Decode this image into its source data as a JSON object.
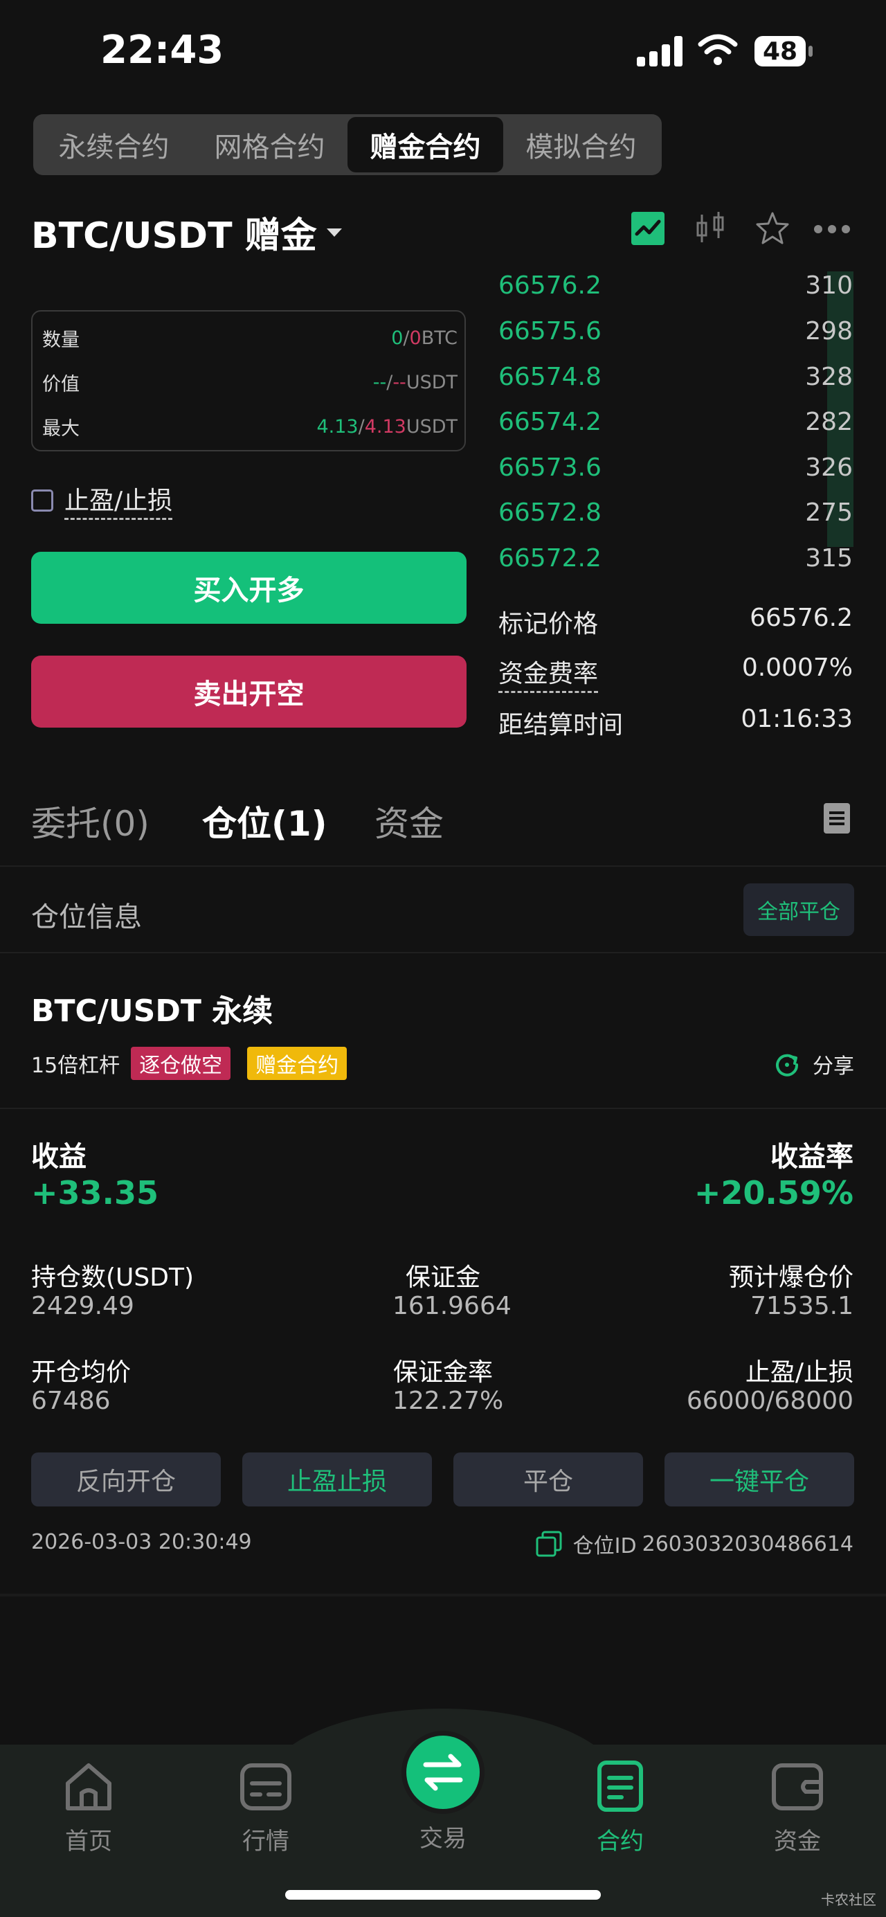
{
  "status_bar": {
    "time": "22:43",
    "battery": "48"
  },
  "top_tabs": [
    {
      "label": "永续合约",
      "active": false
    },
    {
      "label": "网格合约",
      "active": false
    },
    {
      "label": "赠金合约",
      "active": true
    },
    {
      "label": "模拟合约",
      "active": false
    }
  ],
  "pair": {
    "title": "BTC/USDT 赠金"
  },
  "order_info": {
    "rows": [
      {
        "label": "数量",
        "v1": "0",
        "sep": "/",
        "v2": "0",
        "unit": "BTC"
      },
      {
        "label": "价值",
        "v1": "--",
        "sep": "/",
        "v2": "--",
        "unit": "USDT"
      },
      {
        "label": "最大",
        "v1": "4.13",
        "sep": "/",
        "v2": "4.13",
        "unit": "USDT"
      }
    ]
  },
  "tpsl": {
    "label": "止盈/止损"
  },
  "buttons": {
    "buy": "买入开多",
    "sell": "卖出开空"
  },
  "order_book": [
    {
      "price": "66576.2",
      "qty": "310"
    },
    {
      "price": "66575.6",
      "qty": "298"
    },
    {
      "price": "66574.8",
      "qty": "328"
    },
    {
      "price": "66574.2",
      "qty": "282"
    },
    {
      "price": "66573.6",
      "qty": "326"
    },
    {
      "price": "66572.8",
      "qty": "275"
    },
    {
      "price": "66572.2",
      "qty": "315"
    }
  ],
  "market_stats": {
    "mark_label": "标记价格",
    "mark_value": "66576.2",
    "funding_label": "资金费率",
    "funding_value": "0.0007%",
    "settle_label": "距结算时间",
    "settle_value": "01:16:33"
  },
  "section_tabs": [
    {
      "label": "委托(0)",
      "active": false
    },
    {
      "label": "仓位(1)",
      "active": true
    },
    {
      "label": "资金",
      "active": false
    }
  ],
  "position_header": {
    "title": "仓位信息",
    "close_all": "全部平仓"
  },
  "position": {
    "symbol": "BTC/USDT 永续",
    "leverage": "15倍杠杆",
    "tag_short": "逐仓做空",
    "tag_bonus": "赠金合约",
    "share": "分享",
    "pnl_label": "收益",
    "pnl_value": "+33.35",
    "roe_label": "收益率",
    "roe_value": "+20.59%",
    "size_label": "持仓数(USDT)",
    "size_value": "2429.49",
    "margin_label": "保证金",
    "margin_value": "161.9664",
    "liq_label": "预计爆仓价",
    "liq_value": "71535.1",
    "entry_label": "开仓均价",
    "entry_value": "67486",
    "margin_ratio_label": "保证金率",
    "margin_ratio_value": "122.27%",
    "tpsl_label": "止盈/止损",
    "tpsl_value": "66000/68000",
    "actions": {
      "reverse": "反向开仓",
      "tpsl": "止盈止损",
      "close": "平仓",
      "close_all": "一键平仓"
    },
    "timestamp": "2026-03-03 20:30:49",
    "id_label": "仓位ID",
    "id_value": "2603032030486614"
  },
  "bottom_nav": [
    {
      "label": "首页",
      "icon": "home-icon"
    },
    {
      "label": "行情",
      "icon": "market-icon"
    },
    {
      "label": "交易",
      "icon": "swap-icon"
    },
    {
      "label": "合约",
      "icon": "contract-icon"
    },
    {
      "label": "资金",
      "icon": "wallet-icon"
    }
  ],
  "watermark": "卡农社区",
  "colors": {
    "green": "#1fbf7a",
    "red": "#d13a63",
    "yellow": "#f0b90b",
    "bg": "#121212"
  }
}
